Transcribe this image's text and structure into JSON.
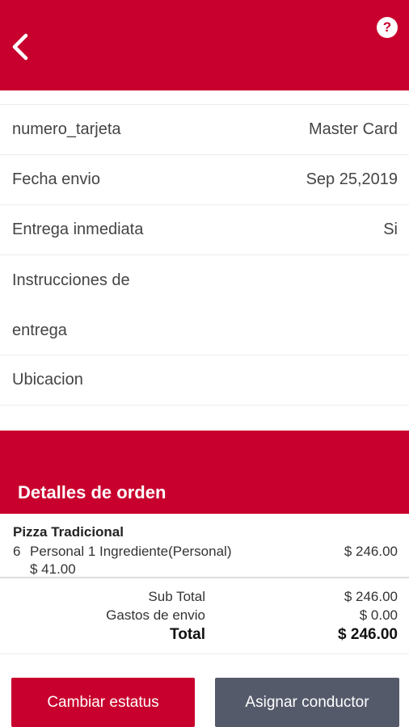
{
  "appbar": {
    "back_icon": "chevron-left-icon",
    "help_label": "?"
  },
  "details": [
    {
      "label": "numero_tarjeta",
      "value": "Master Card"
    },
    {
      "label": "Fecha envio",
      "value": "Sep 25,2019"
    },
    {
      "label": "Entrega inmediata",
      "value": "Si"
    },
    {
      "label": "Instrucciones de entrega",
      "value": ""
    },
    {
      "label": "Ubicacion",
      "value": ""
    }
  ],
  "order": {
    "section_title": "Detalles de orden",
    "product": {
      "name": "Pizza Tradicional",
      "qty": "6",
      "description": "Personal 1 Ingrediente(Personal)",
      "line_total": "$ 246.00",
      "unit_price": "$ 41.00"
    },
    "subtotal_label": "Sub Total",
    "subtotal_value": "$ 246.00",
    "shipping_label": "Gastos de envio",
    "shipping_value": "$ 0.00",
    "total_label": "Total",
    "total_value": "$ 246.00"
  },
  "buttons": {
    "change_status": "Cambiar estatus",
    "assign_driver": "Asignar conductor"
  },
  "colors": {
    "primary": "#c8002d",
    "secondary_button": "#555a6b"
  }
}
